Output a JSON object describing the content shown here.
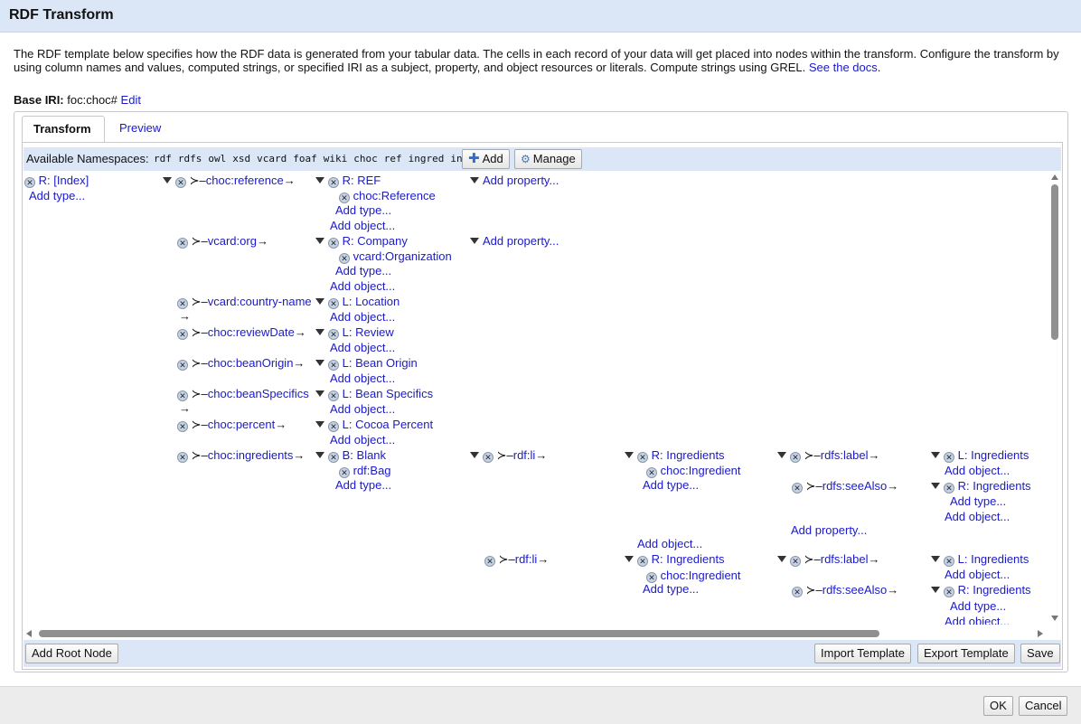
{
  "dialog": {
    "title": "RDF Transform",
    "description": "The RDF template below specifies how the RDF data is generated from your tabular data. The cells in each record of your data will get placed into nodes within the transform. Configure the transform by using column names and values, computed strings, or specified IRI as a subject, property, and object resources or literals. Compute strings using GREL.",
    "docs_link": "See the docs",
    "docs_after": ".",
    "base_iri_label": "Base IRI:",
    "base_iri_value": "foc:choc#",
    "base_iri_edit": "Edit"
  },
  "tabs": [
    {
      "label": "Transform",
      "active": true
    },
    {
      "label": "Preview",
      "active": false
    }
  ],
  "namespaces": {
    "label": "Available Namespaces:",
    "items": [
      "rdf",
      "rdfs",
      "owl",
      "xsd",
      "vcard",
      "foaf",
      "wiki",
      "choc",
      "ref",
      "ingred",
      "info"
    ],
    "add_label": "Add",
    "manage_label": "Manage"
  },
  "tree": {
    "root": "R: [Index]",
    "add_type": "Add type...",
    "add_object": "Add object...",
    "add_property": "Add property...",
    "p_reference": "choc:reference",
    "o_ref": "R: REF",
    "o_ref_type": "choc:Reference",
    "p_org": "vcard:org",
    "o_company": "R: Company",
    "o_company_type": "vcard:Organization",
    "p_country": "vcard:country-name",
    "o_location": "L: Location",
    "p_review": "choc:reviewDate",
    "o_review": "L: Review",
    "p_beanorigin": "choc:beanOrigin",
    "o_beanorigin": "L: Bean Origin",
    "p_beanspec": "choc:beanSpecifics",
    "o_beanspec": "L: Bean Specifics",
    "p_percent": "choc:percent",
    "o_percent": "L: Cocoa Percent",
    "p_ingredients": "choc:ingredients",
    "o_blank": "B: Blank",
    "o_blank_type": "rdf:Bag",
    "p_li": "rdf:li",
    "o_ingr": "R: Ingredients",
    "o_ingr_type": "choc:Ingredient",
    "p_label": "rdfs:label",
    "o_l_ingr": "L: Ingredients",
    "p_seealso": "rdfs:seeAlso",
    "o_r_ingr": "R: Ingredients"
  },
  "footer": {
    "add_root": "Add Root Node",
    "import": "Import Template",
    "export": "Export Template",
    "save": "Save"
  },
  "bottom": {
    "ok": "OK",
    "cancel": "Cancel"
  },
  "icons": {
    "remove": "close-circle-icon",
    "expand": "triangle-down-icon",
    "add": "plus-icon",
    "manage": "gear-icon"
  }
}
